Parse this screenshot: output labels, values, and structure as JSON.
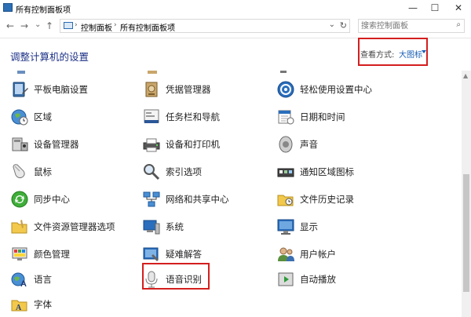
{
  "window": {
    "title": "所有控制面板项",
    "minimize": "—",
    "maximize": "☐",
    "close": "✕"
  },
  "nav": {
    "back": "←",
    "forward": "→",
    "recent": "⌄",
    "up": "↑"
  },
  "address": {
    "crumbs": [
      "控制面板",
      "所有控制面板项"
    ],
    "sep": "›",
    "dropdown": "⌄",
    "refresh": "↻"
  },
  "search": {
    "placeholder": "搜索控制面板",
    "icon": "⌕"
  },
  "header": {
    "title": "调整计算机的设置"
  },
  "viewby": {
    "label": "查看方式:",
    "value": "大图标"
  },
  "items": [
    {
      "label": "平板电脑设置",
      "icon": "tablet-icon"
    },
    {
      "label": "区域",
      "icon": "globe-clock-icon"
    },
    {
      "label": "设备管理器",
      "icon": "device-manager-icon"
    },
    {
      "label": "鼠标",
      "icon": "mouse-icon"
    },
    {
      "label": "同步中心",
      "icon": "sync-center-icon"
    },
    {
      "label": "文件资源管理器选项",
      "icon": "folder-options-icon"
    },
    {
      "label": "颜色管理",
      "icon": "color-management-icon"
    },
    {
      "label": "语言",
      "icon": "language-icon"
    },
    {
      "label": "字体",
      "icon": "fonts-icon"
    },
    {
      "label": "凭据管理器",
      "icon": "credential-vault-icon"
    },
    {
      "label": "任务栏和导航",
      "icon": "taskbar-icon"
    },
    {
      "label": "设备和打印机",
      "icon": "printer-icon"
    },
    {
      "label": "索引选项",
      "icon": "indexing-icon"
    },
    {
      "label": "网络和共享中心",
      "icon": "network-icon"
    },
    {
      "label": "系统",
      "icon": "system-icon"
    },
    {
      "label": "疑难解答",
      "icon": "troubleshoot-icon"
    },
    {
      "label": "语音识别",
      "icon": "microphone-icon"
    },
    {
      "label": "轻松使用设置中心",
      "icon": "ease-of-access-icon"
    },
    {
      "label": "日期和时间",
      "icon": "calendar-clock-icon"
    },
    {
      "label": "声音",
      "icon": "speaker-icon"
    },
    {
      "label": "通知区域图标",
      "icon": "notification-icons-icon"
    },
    {
      "label": "文件历史记录",
      "icon": "file-history-icon"
    },
    {
      "label": "显示",
      "icon": "display-icon"
    },
    {
      "label": "用户帐户",
      "icon": "user-accounts-icon"
    },
    {
      "label": "自动播放",
      "icon": "autoplay-icon"
    }
  ]
}
